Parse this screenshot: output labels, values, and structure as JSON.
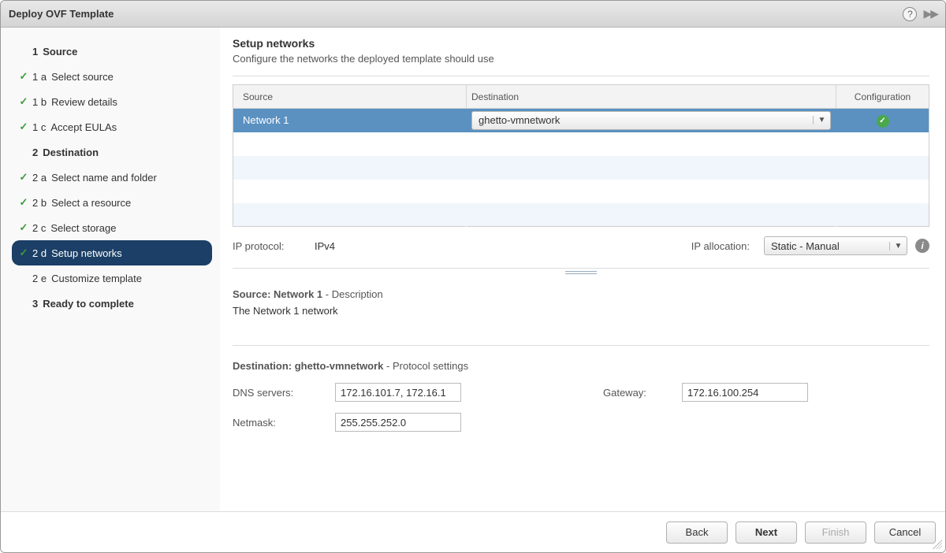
{
  "window": {
    "title": "Deploy OVF Template"
  },
  "sidebar": {
    "steps": [
      {
        "num": "1",
        "label": "Source",
        "type": "section"
      },
      {
        "num": "1 a",
        "label": "Select source",
        "type": "done"
      },
      {
        "num": "1 b",
        "label": "Review details",
        "type": "done"
      },
      {
        "num": "1 c",
        "label": "Accept EULAs",
        "type": "done"
      },
      {
        "num": "2",
        "label": "Destination",
        "type": "section"
      },
      {
        "num": "2 a",
        "label": "Select name and folder",
        "type": "done"
      },
      {
        "num": "2 b",
        "label": "Select a resource",
        "type": "done"
      },
      {
        "num": "2 c",
        "label": "Select storage",
        "type": "done"
      },
      {
        "num": "2 d",
        "label": "Setup networks",
        "type": "active"
      },
      {
        "num": "2 e",
        "label": "Customize template",
        "type": "pending"
      },
      {
        "num": "3",
        "label": "Ready to complete",
        "type": "section"
      }
    ]
  },
  "page": {
    "title": "Setup networks",
    "subtitle": "Configure the networks the deployed template should use"
  },
  "table": {
    "headers": {
      "source": "Source",
      "destination": "Destination",
      "config": "Configuration"
    },
    "row": {
      "source": "Network 1",
      "destination": "ghetto-vmnetwork",
      "config_ok": true
    }
  },
  "ip": {
    "protocol_label": "IP protocol:",
    "protocol_value": "IPv4",
    "allocation_label": "IP allocation:",
    "allocation_value": "Static - Manual"
  },
  "source_section": {
    "prefix": "Source: ",
    "name": "Network 1",
    "suffix": " - Description",
    "description": "The Network 1 network"
  },
  "dest_section": {
    "prefix": "Destination: ",
    "name": "ghetto-vmnetwork",
    "suffix": " - Protocol settings",
    "dns_label": "DNS servers:",
    "dns_value": "172.16.101.7, 172.16.1",
    "gateway_label": "Gateway:",
    "gateway_value": "172.16.100.254",
    "netmask_label": "Netmask:",
    "netmask_value": "255.255.252.0"
  },
  "footer": {
    "back": "Back",
    "next": "Next",
    "finish": "Finish",
    "cancel": "Cancel"
  }
}
